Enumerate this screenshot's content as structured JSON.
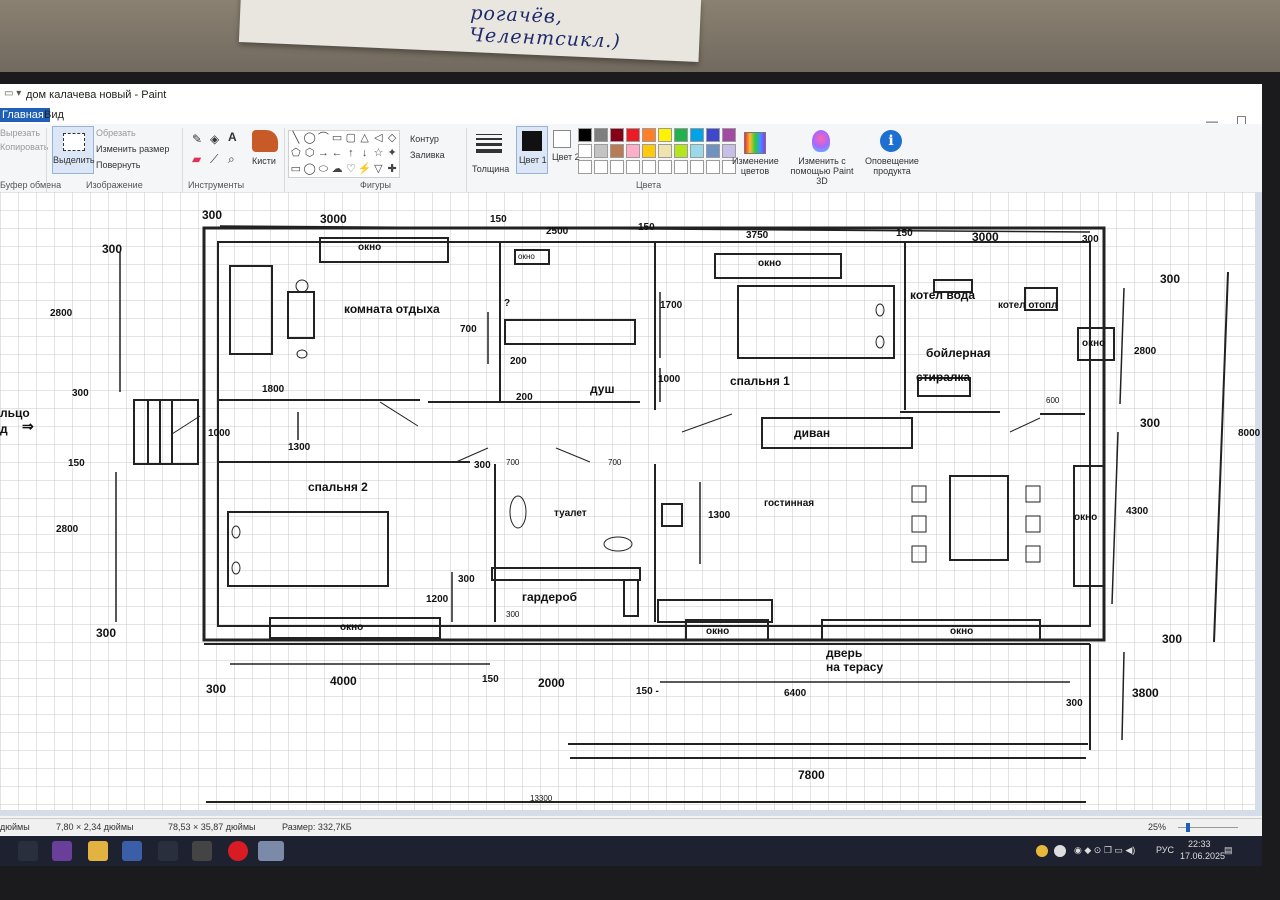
{
  "note": {
    "text": "рогачёв, Челентсикл.)"
  },
  "window": {
    "title": "дом калачева новый - Paint",
    "controls": {
      "minimize": "—",
      "maximize": "☐",
      "close": "✕"
    }
  },
  "tabs": [
    "Главная",
    "Вид"
  ],
  "ribbon": {
    "clipboard": {
      "cut": "Вырезать",
      "copy": "Копировать",
      "group": "Буфер обмена"
    },
    "image": {
      "select": "Выделить",
      "crop": "Обрезать",
      "resize": "Изменить размер",
      "rotate": "Повернуть",
      "group": "Изображение"
    },
    "tools": {
      "group": "Инструменты",
      "text_tool": "A"
    },
    "brushes": {
      "label": "Кисти"
    },
    "shapes": {
      "outline": "Контур",
      "fill": "Заливка",
      "group": "Фигуры",
      "glyphs": [
        "╲",
        "◯",
        "⌒",
        "▭",
        "▢",
        "△",
        "◁",
        "◇",
        "⬠",
        "⬡",
        "→",
        "←",
        "↑",
        "↓",
        "☆",
        "✦",
        "▭",
        "◯",
        "⬭",
        "☁",
        "♡",
        "⚡",
        "▽",
        "✚"
      ]
    },
    "thickness": {
      "label": "Толщина"
    },
    "colors": {
      "color1": "Цвет 1",
      "color2": "Цвет 2",
      "group": "Цвета",
      "palette": [
        "#000000",
        "#7f7f7f",
        "#880015",
        "#ed1c24",
        "#ff7f27",
        "#fff200",
        "#22b14c",
        "#00a2e8",
        "#3f48cc",
        "#a349a4",
        "#ffffff",
        "#c3c3c3",
        "#b97a57",
        "#ffaec9",
        "#ffc90e",
        "#efe4b0",
        "#b5e61d",
        "#99d9ea",
        "#7092be",
        "#c8bfe7",
        "#ffffff",
        "#ffffff",
        "#ffffff",
        "#ffffff",
        "#ffffff",
        "#ffffff",
        "#ffffff",
        "#ffffff",
        "#ffffff",
        "#ffffff"
      ]
    },
    "edit_colors": "Изменение цветов",
    "paint3d": "Изменить с помощью Paint 3D",
    "product_alert": "Оповещение продукта"
  },
  "plan": {
    "rooms": {
      "rest": "комната отдыха",
      "shower": "душ",
      "bedroom1": "спальня 1",
      "boiler_room": "бойлерная",
      "water_boiler": "котел вода",
      "heating_boiler": "котел отопл",
      "washer": "стиралка",
      "sofa": "диван",
      "bedroom2": "спальня 2",
      "toilet": "туалет",
      "living": "гостинная",
      "wardrobe": "гардероб",
      "terrace_door_1": "дверь",
      "terrace_door_2": "на терасу",
      "entrance": "льцо",
      "entrance_2": "д"
    },
    "window_label": "окно",
    "question_mark": "?",
    "dims": {
      "top": [
        "300",
        "3000",
        "150",
        "2500",
        "150",
        "3750",
        "150",
        "3000",
        "300"
      ],
      "left": [
        "300",
        "2800",
        "300",
        "150",
        "2800",
        "300"
      ],
      "right": [
        "300",
        "2800",
        "300",
        "8000",
        "4300",
        "300",
        "3800"
      ],
      "bottom": [
        "300",
        "4000",
        "150",
        "2000",
        "150 -",
        "6400",
        "300",
        "7800",
        "13300"
      ],
      "inner": [
        "1700",
        "700",
        "200",
        "1000",
        "200",
        "1800",
        "1000",
        "1300",
        "300",
        "700",
        "700",
        "600",
        "1300",
        "300",
        "1200",
        "300"
      ]
    }
  },
  "status": {
    "left_text": "дюймы",
    "selection": "7,80 × 2,34 дюймы",
    "image_size": "78,53 × 35,87 дюймы",
    "file_size": "Размер: 332,7КБ",
    "zoom": "25%"
  },
  "tray": {
    "lang": "РУС",
    "time": "22:33",
    "date": "17.06.2025"
  }
}
